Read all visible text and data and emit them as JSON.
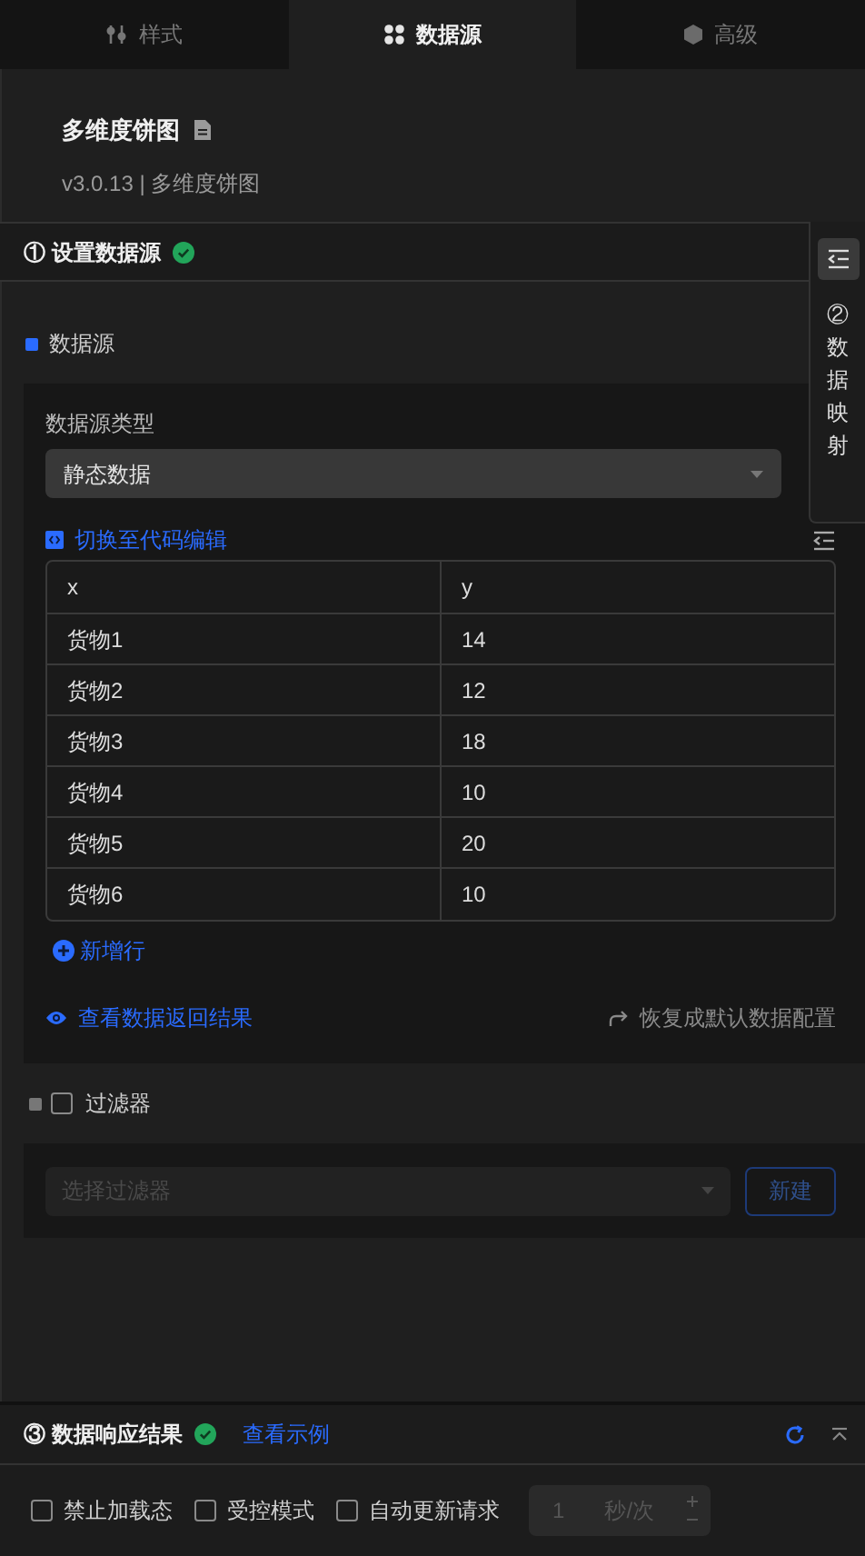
{
  "tabs": [
    {
      "label": "样式",
      "kind": "style",
      "selected": false
    },
    {
      "label": "数据源",
      "kind": "data",
      "selected": true
    },
    {
      "label": "高级",
      "kind": "advanced",
      "selected": false
    }
  ],
  "component": {
    "title": "多维度饼图",
    "version": "v3.0.13 | 多维度饼图"
  },
  "section1": {
    "title": "① 设置数据源",
    "done": true
  },
  "side_panel": {
    "title": "②数据映射"
  },
  "datasource": {
    "label": "数据源",
    "type_label": "数据源类型",
    "type_value": "静态数据",
    "code_link": "切换至代码编辑",
    "table": {
      "columns": [
        "x",
        "y"
      ],
      "rows": [
        [
          "货物1",
          "14"
        ],
        [
          "货物2",
          "12"
        ],
        [
          "货物3",
          "18"
        ],
        [
          "货物4",
          "10"
        ],
        [
          "货物5",
          "20"
        ],
        [
          "货物6",
          "10"
        ]
      ]
    },
    "add_row": "新增行",
    "view_result": "查看数据返回结果",
    "restore": "恢复成默认数据配置"
  },
  "filter": {
    "label": "过滤器",
    "checked": false,
    "placeholder": "选择过滤器",
    "new_button": "新建"
  },
  "section3": {
    "title": "③ 数据响应结果",
    "done": true,
    "example_link": "查看示例",
    "options": [
      {
        "label": "禁止加载态",
        "checked": false
      },
      {
        "label": "受控模式",
        "checked": false
      },
      {
        "label": "自动更新请求",
        "checked": false
      }
    ],
    "interval": {
      "value": "1",
      "unit": "秒/次"
    }
  }
}
